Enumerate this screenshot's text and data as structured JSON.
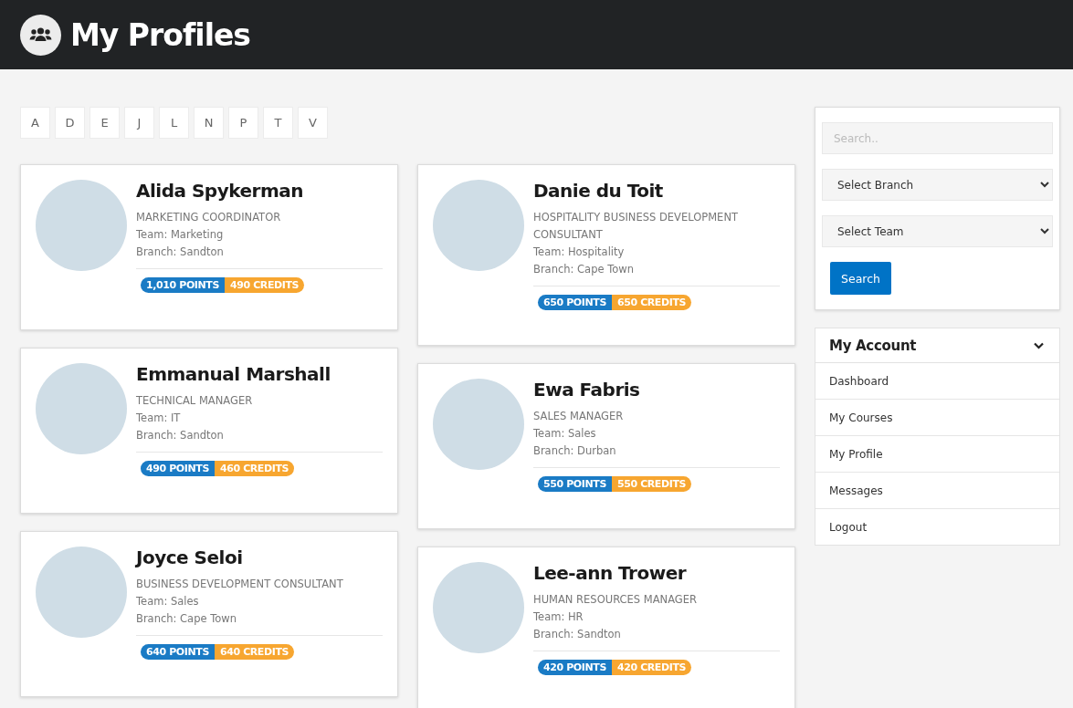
{
  "header": {
    "title": "My Profiles"
  },
  "letters": [
    "A",
    "D",
    "E",
    "J",
    "L",
    "N",
    "P",
    "T",
    "V"
  ],
  "profiles": [
    {
      "name": "Alida Spykerman",
      "title": "MARKETING COORDINATOR",
      "team": "Team: Marketing",
      "branch": "Branch: Sandton",
      "points": "1,010 POINTS",
      "credits": "490 CREDITS"
    },
    {
      "name": "Danie du Toit",
      "title": "HOSPITALITY BUSINESS DEVELOPMENT CONSULTANT",
      "team": "Team: Hospitality",
      "branch": "Branch: Cape Town",
      "points": "650 POINTS",
      "credits": "650 CREDITS"
    },
    {
      "name": "Emmanual Marshall",
      "title": "TECHNICAL MANAGER",
      "team": "Team: IT",
      "branch": "Branch: Sandton",
      "points": "490 POINTS",
      "credits": "460 CREDITS"
    },
    {
      "name": "Ewa Fabris",
      "title": "SALES MANAGER",
      "team": "Team: Sales",
      "branch": "Branch: Durban",
      "points": "550 POINTS",
      "credits": "550 CREDITS"
    },
    {
      "name": "Joyce Seloi",
      "title": "BUSINESS DEVELOPMENT CONSULTANT",
      "team": "Team: Sales",
      "branch": "Branch: Cape Town",
      "points": "640 POINTS",
      "credits": "640 CREDITS"
    },
    {
      "name": "Lee-ann Trower",
      "title": "HUMAN RESOURCES MANAGER",
      "team": "Team: HR",
      "branch": "Branch: Sandton",
      "points": "420 POINTS",
      "credits": "420 CREDITS"
    }
  ],
  "filters": {
    "search": {
      "placeholder": "Search.."
    },
    "branch_select": "Select Branch",
    "team_select": "Select Team",
    "search_button": "Search"
  },
  "account": {
    "title": "My Account",
    "expanded": true,
    "items": [
      "Dashboard",
      "My Courses",
      "My Profile",
      "Messages",
      "Logout"
    ]
  }
}
